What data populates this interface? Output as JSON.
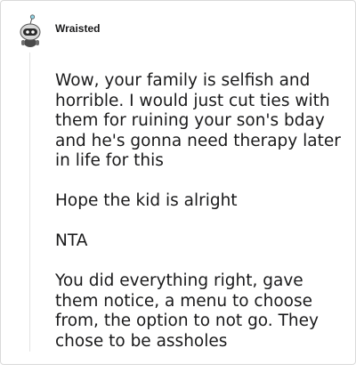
{
  "comment": {
    "author": "Wraisted",
    "avatar_icon": "snoo-robot-avatar-icon",
    "paragraphs": [
      "Wow, your family is selfish and horrible. I would just cut ties with them for ruining your son's bday and he's gonna need therapy later in life for this",
      "Hope the kid is alright",
      "NTA",
      "You did everything right, gave them notice, a menu to choose from, the option to not go. They chose to be assholes"
    ]
  }
}
